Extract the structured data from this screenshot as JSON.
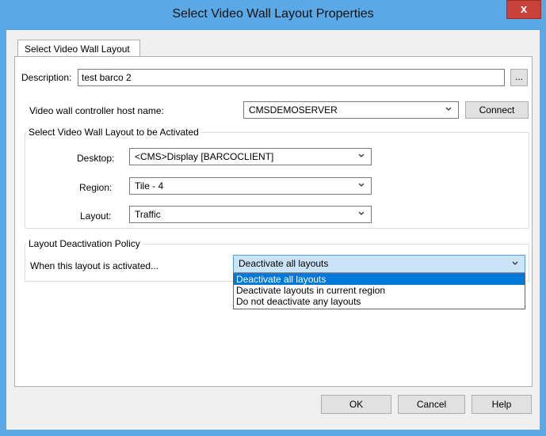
{
  "window": {
    "title": "Select Video Wall Layout Properties",
    "close_label": "x"
  },
  "tab": {
    "label": "Select Video Wall Layout"
  },
  "description": {
    "label": "Description:",
    "value": "test barco 2",
    "browse_label": "..."
  },
  "controller": {
    "label": "Video wall controller host name:",
    "value": "CMSDEMOSERVER",
    "connect_label": "Connect"
  },
  "activate_group": {
    "title": "Select Video Wall Layout to be Activated",
    "desktop": {
      "label": "Desktop:",
      "value": "<CMS>Display [BARCOCLIENT]"
    },
    "region": {
      "label": "Region:",
      "value": "Tile - 4"
    },
    "layout": {
      "label": "Layout:",
      "value": "Traffic"
    }
  },
  "policy_group": {
    "title": "Layout Deactivation Policy",
    "label": "When this layout is activated...",
    "value": "Deactivate all layouts",
    "options": [
      "Deactivate all layouts",
      "Deactivate layouts in current region",
      "Do not deactivate any layouts"
    ]
  },
  "footer": {
    "ok_label": "OK",
    "cancel_label": "Cancel",
    "help_label": "Help"
  },
  "colors": {
    "titlebar": "#5aa9e6",
    "close": "#c9423a",
    "selection": "#0078d7"
  }
}
